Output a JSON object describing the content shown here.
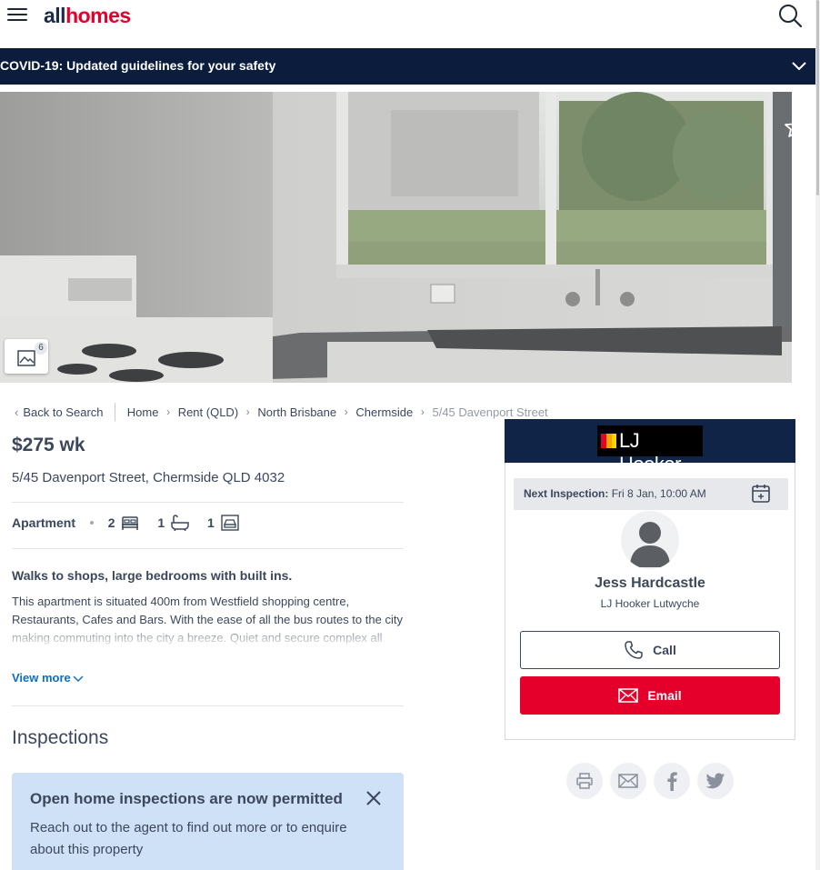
{
  "header": {
    "logo_part1": "all",
    "logo_part2": "homes"
  },
  "covid_banner": {
    "text": "COVID-19: Updated guidelines for your safety"
  },
  "gallery": {
    "photo_count": "6"
  },
  "breadcrumb": {
    "back": "Back to Search",
    "items": [
      "Home",
      "Rent (QLD)",
      "North Brisbane",
      "Chermside"
    ],
    "current": "5/45 Davenport Street"
  },
  "listing": {
    "price": "$275 wk",
    "address": "5/45 Davenport Street, Chermside QLD 4032",
    "type": "Apartment",
    "bedrooms": "2",
    "bathrooms": "1",
    "parking": "1",
    "headline": "Walks to shops, large bedrooms with built ins.",
    "description": "This apartment is situated 400m from Westfield shopping centre, Restaurants, Cafes and Bars. With the ease of all the bus routes to the city making commuting into the city a breeze. Quiet and secure complex all",
    "view_more": "View more"
  },
  "inspections": {
    "title": "Inspections",
    "notice_title": "Open home inspections are now permitted",
    "notice_body": "Reach out to the agent to find out more or to enquire about this property"
  },
  "agent_card": {
    "agency_logo_text": "LJ Hooker",
    "next_inspection_label": "Next Inspection:",
    "next_inspection_value": "Fri 8 Jan, 10:00 AM",
    "agent_name": "Jess Hardcastle",
    "agent_office": "LJ Hooker Lutwyche",
    "call_label": "Call",
    "email_label": "Email"
  },
  "colors": {
    "brand_red": "#e4002b",
    "navy": "#0b1c3d",
    "agency_navy": "#0f2447",
    "notice_blue": "#cfe1f7",
    "link_blue": "#0d6fbf"
  },
  "share_icons": [
    "print-icon",
    "mail-icon",
    "facebook-icon",
    "twitter-icon"
  ]
}
